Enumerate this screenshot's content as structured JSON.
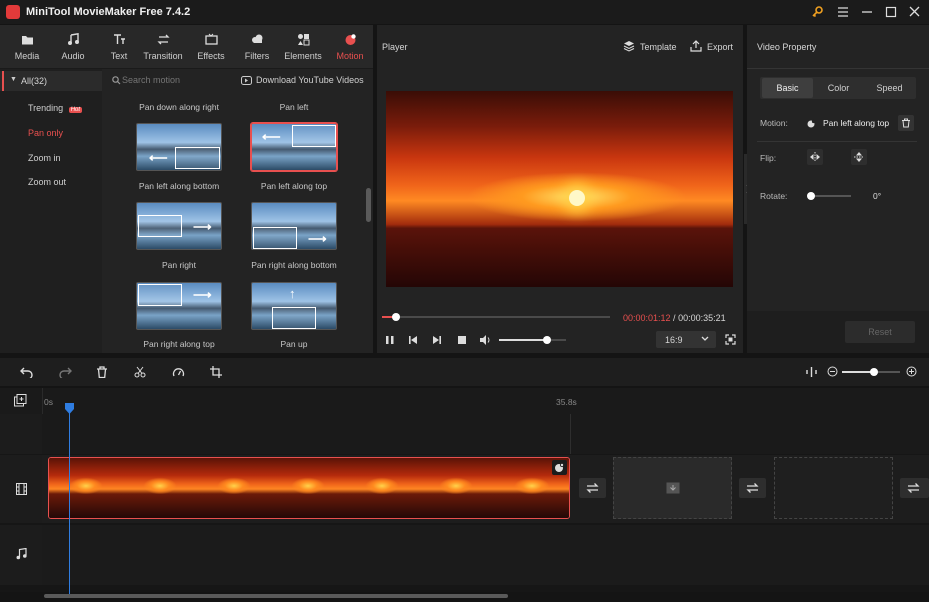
{
  "app": {
    "title": "MiniTool MovieMaker Free 7.4.2"
  },
  "toolbar": {
    "tabs": [
      {
        "label": "Media",
        "icon": "folder-icon"
      },
      {
        "label": "Audio",
        "icon": "music-note-icon"
      },
      {
        "label": "Text",
        "icon": "text-icon"
      },
      {
        "label": "Transition",
        "icon": "swap-icon"
      },
      {
        "label": "Effects",
        "icon": "effects-icon"
      },
      {
        "label": "Filters",
        "icon": "cloud-icon"
      },
      {
        "label": "Elements",
        "icon": "elements-icon"
      },
      {
        "label": "Motion",
        "icon": "motion-icon"
      }
    ],
    "active": "Motion"
  },
  "categories": {
    "all": "All(32)",
    "items": [
      "Trending",
      "Pan only",
      "Zoom in",
      "Zoom out"
    ],
    "hot_badge": "Hot",
    "active": "Pan only"
  },
  "search": {
    "placeholder": "Search motion",
    "download_label": "Download YouTube Videos"
  },
  "gallery": {
    "top_labels": [
      "Pan down along right",
      "Pan left"
    ],
    "items": [
      {
        "label": "Pan left along bottom"
      },
      {
        "label": "Pan left along top",
        "selected": true
      },
      {
        "label": "Pan right"
      },
      {
        "label": "Pan right along bottom"
      },
      {
        "label": "Pan right along top"
      },
      {
        "label": "Pan up"
      }
    ]
  },
  "player": {
    "title": "Player",
    "template_label": "Template",
    "export_label": "Export",
    "current_time": "00:00:01:12",
    "separator": " / ",
    "total_time": "00:00:35:21",
    "aspect": "16:9",
    "progress": 0.06,
    "volume": 0.72
  },
  "video_property": {
    "title": "Video Property",
    "tabs": [
      "Basic",
      "Color",
      "Speed"
    ],
    "active_tab": "Basic",
    "motion_label": "Motion:",
    "motion_value": "Pan left along top",
    "flip_label": "Flip:",
    "rotate_label": "Rotate:",
    "rotate_value": "0°",
    "reset_label": "Reset"
  },
  "timeline": {
    "ruler_start": "0s",
    "ruler_mark": "35.8s",
    "zoom_level": 0.55
  },
  "colors": {
    "accent": "#e8504f",
    "playhead": "#2f7de1",
    "panel": "#232323"
  }
}
